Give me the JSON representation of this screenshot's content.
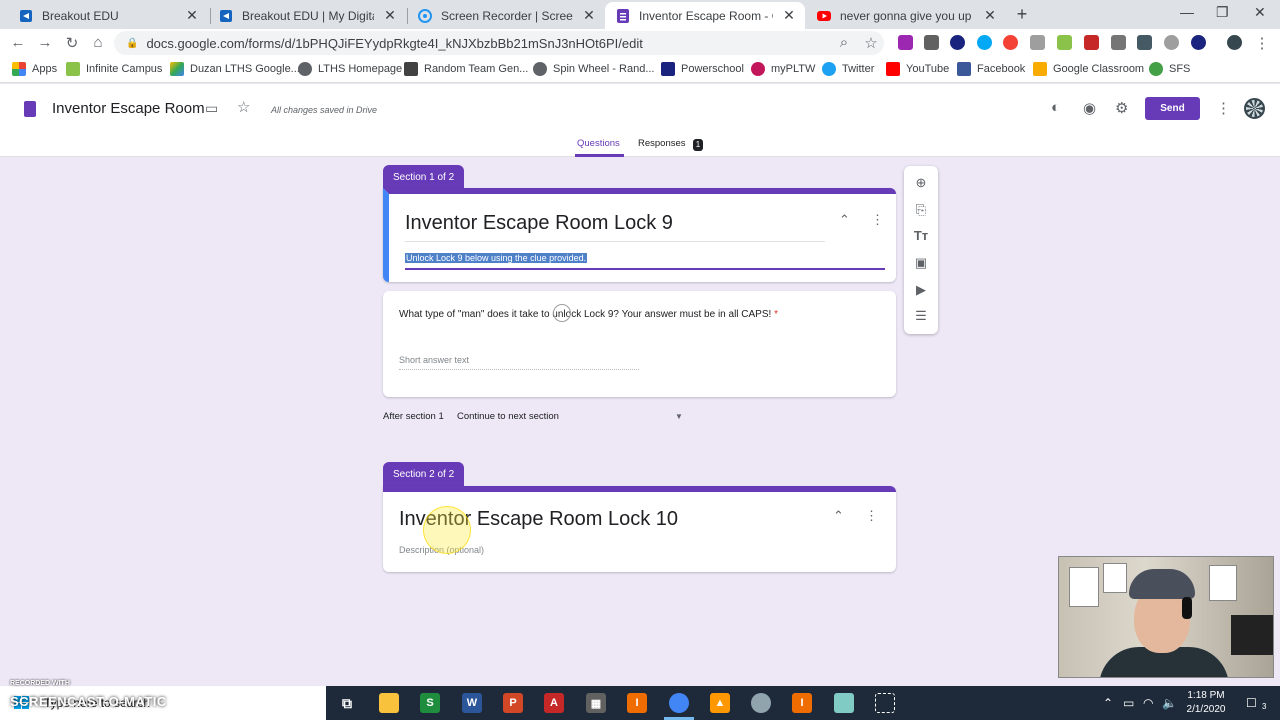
{
  "browser": {
    "tabs": [
      {
        "title": "Breakout EDU",
        "icon": "breakout-icon",
        "color": "#1565c0"
      },
      {
        "title": "Breakout EDU | My Digital Game",
        "icon": "breakout-icon",
        "color": "#1565c0"
      },
      {
        "title": "Screen Recorder | Screencast-O-Matic",
        "icon": "screencast-icon",
        "color": "#2196f3"
      },
      {
        "title": "Inventor Escape Room - Google Forms",
        "icon": "forms-icon",
        "color": "#673ab7"
      },
      {
        "title": "never gonna give you up - YouTube",
        "icon": "youtube-icon",
        "color": "#ff0000"
      }
    ],
    "url": "docs.google.com/forms/d/1bPHQJiFEYydpRkgte4I_kNJXbzbBb21mSnJ3nHOt6PI/edit",
    "bookmarks": [
      {
        "label": "Apps",
        "color": "#4285f4"
      },
      {
        "label": "Infinite Campus",
        "color": "#8bc34a"
      },
      {
        "label": "Duzan LTHS Google...",
        "color": "#fbbc04"
      },
      {
        "label": "LTHS Homepage",
        "color": "#5f6368"
      },
      {
        "label": "Random Team Gen...",
        "color": "#424242"
      },
      {
        "label": "Spin Wheel - Rand...",
        "color": "#5f6368"
      },
      {
        "label": "Powerschool",
        "color": "#1a237e"
      },
      {
        "label": "myPLTW",
        "color": "#c2185b"
      },
      {
        "label": "Twitter",
        "color": "#1da1f2"
      },
      {
        "label": "YouTube",
        "color": "#ff0000"
      },
      {
        "label": "Facebook",
        "color": "#3b5998"
      },
      {
        "label": "Google Classroom",
        "color": "#f9ab00"
      },
      {
        "label": "SFS",
        "color": "#43a047"
      }
    ]
  },
  "forms": {
    "doc_title": "Inventor Escape Room",
    "saved_status": "All changes saved in Drive",
    "send_label": "Send",
    "tab_questions": "Questions",
    "tab_responses": "Responses",
    "responses_count": "1",
    "accent": "#673ab7"
  },
  "section1": {
    "tag": "Section 1 of 2",
    "title": "Inventor Escape Room Lock 9",
    "description": "Unlock Lock 9 below using the clue provided.",
    "question": "What type of \"man\" does it take to unlock Lock 9?  Your answer must be in all CAPS!",
    "required_mark": "*",
    "answer_placeholder": "Short answer text",
    "after_label": "After section 1",
    "after_value": "Continue to next section"
  },
  "section2": {
    "tag": "Section 2 of 2",
    "title": "Inventor Escape Room Lock 10",
    "description_placeholder": "Description (optional)"
  },
  "taskbar": {
    "search_placeholder": "Type here to search",
    "time": "1:18 PM",
    "date": "2/1/2020",
    "notification_count": "3"
  },
  "watermark": {
    "small": "RECORDED WITH",
    "big": "SCREENCAST-O-MATIC"
  }
}
